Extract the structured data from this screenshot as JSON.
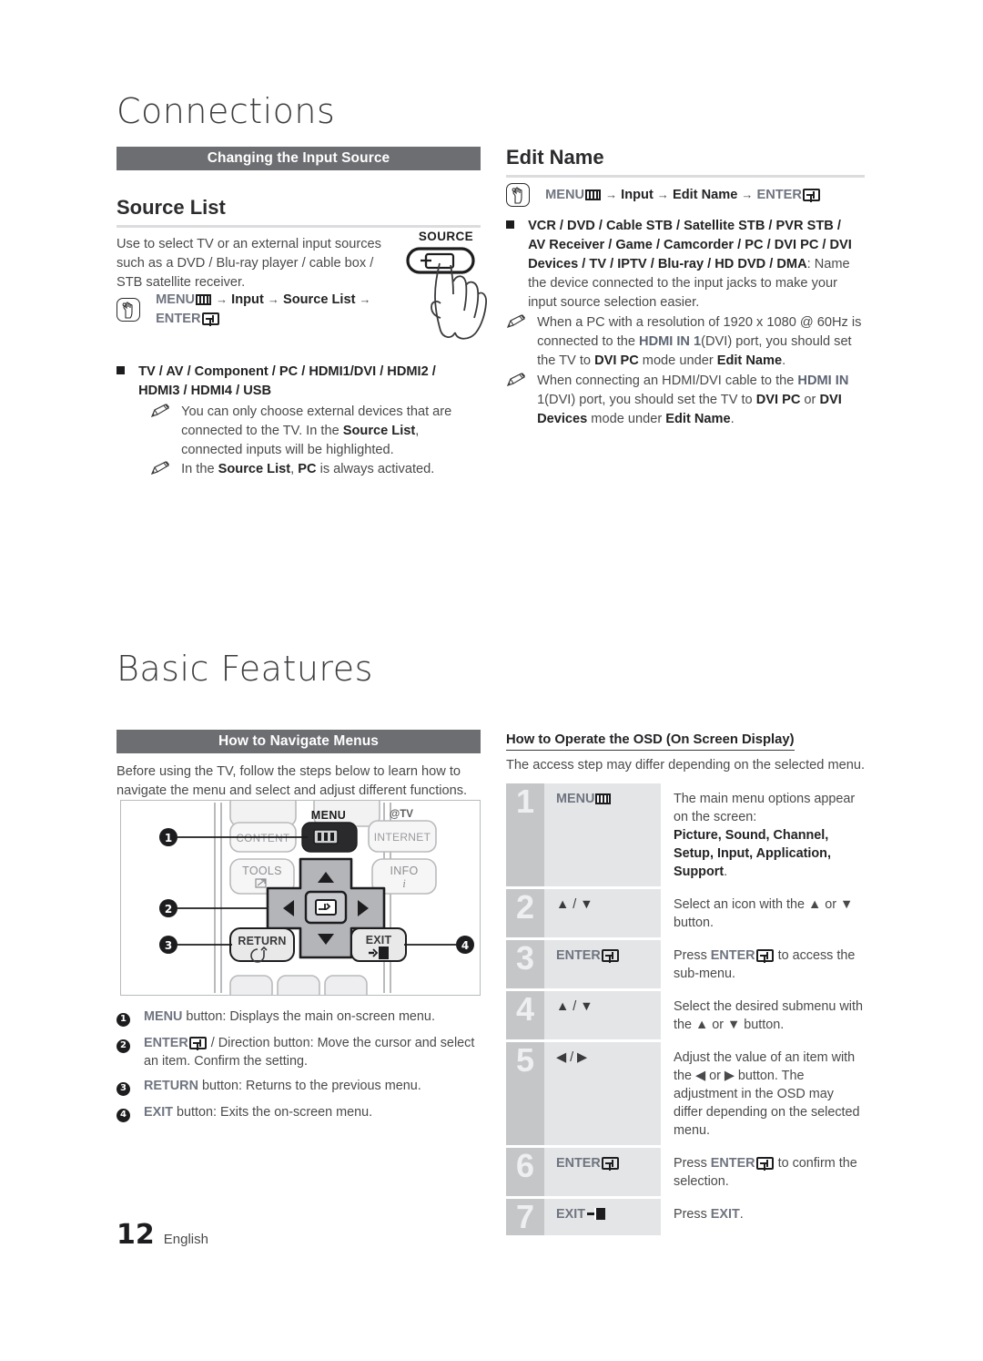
{
  "chapters": {
    "connections": "Connections",
    "basic_features": "Basic Features"
  },
  "section_bars": {
    "changing_input_source": "Changing the Input Source",
    "how_to_navigate_menus": "How to Navigate Menus"
  },
  "source_list": {
    "heading": "Source List",
    "intro": "Use to select TV or an external input sources such as a DVD / Blu-ray player / cable box / STB satellite receiver.",
    "menu_path": {
      "menu": "MENU",
      "arrow": "→",
      "input": "Input",
      "source_list": "Source List",
      "enter": "ENTER"
    },
    "inputs_bullet": "TV / AV / Component / PC / HDMI1/DVI / HDMI2 / HDMI3 / HDMI4 / USB",
    "notes": [
      "You can only choose external devices that are connected to the TV. In the Source List, connected inputs will be highlighted.",
      "In the Source List, PC is always activated."
    ],
    "source_button_label": "SOURCE"
  },
  "edit_name": {
    "heading": "Edit Name",
    "menu_path": {
      "menu": "MENU",
      "arrow": "→",
      "input": "Input",
      "edit_name": "Edit Name",
      "enter": "ENTER"
    },
    "devices_bold": "VCR / DVD / Cable STB / Satellite STB / PVR STB / AV Receiver / Game / Camcorder / PC / DVI PC / DVI Devices / TV / IPTV / Blu-ray / HD DVD / DMA",
    "devices_tail": ": Name the device connected to the input jacks to make your input source selection easier.",
    "notes": [
      "When a PC with a resolution of 1920 x 1080 @ 60Hz is connected to the HDMI IN 1(DVI) port, you should set the TV to DVI PC mode under Edit Name.",
      "When connecting an HDMI/DVI cable to the HDMI IN 1(DVI) port, you should set the TV to DVI PC or DVI Devices mode under Edit Name."
    ]
  },
  "navigate_menus": {
    "intro": "Before using the TV, follow the steps below to learn how to navigate the menu and select and adjust different functions.",
    "remote_buttons": {
      "content": "CONTENT",
      "menu_label": "MENU",
      "attv": "@TV",
      "internet": "INTERNET",
      "tools": "TOOLS",
      "info": "INFO",
      "return": "RETURN",
      "exit": "EXIT"
    },
    "callouts": [
      "1",
      "2",
      "3",
      "4"
    ],
    "legend": [
      {
        "num": "1",
        "key": "MENU",
        "text": " button: Displays the main on-screen menu."
      },
      {
        "num": "2",
        "key": "ENTER",
        "text": " / Direction button: Move the cursor and select an item. Confirm the setting."
      },
      {
        "num": "3",
        "key": "RETURN",
        "text": " button: Returns to the previous menu."
      },
      {
        "num": "4",
        "key": "EXIT",
        "text": " button: Exits the on-screen menu."
      }
    ]
  },
  "osd": {
    "title": "How to Operate the OSD (On Screen Display)",
    "subtitle": "The access step may differ depending on the selected menu.",
    "rows": [
      {
        "num": "1",
        "key": "MENU",
        "key_icon": "menu-icon",
        "desc_lead": "The main menu options appear on the screen:",
        "desc_bold": "Picture, Sound, Channel, Setup, Input, Application, Support",
        "desc_tail": "."
      },
      {
        "num": "2",
        "key": "▲ / ▼",
        "key_icon": "",
        "desc_lead": "Select an icon with the ▲ or ▼ button.",
        "desc_bold": "",
        "desc_tail": ""
      },
      {
        "num": "3",
        "key": "ENTER",
        "key_icon": "enter-icon",
        "desc_lead": "Press ENTER to access the sub-menu.",
        "desc_bold": "",
        "desc_tail": ""
      },
      {
        "num": "4",
        "key": "▲ / ▼",
        "key_icon": "",
        "desc_lead": "Select the desired submenu with the ▲ or ▼ button.",
        "desc_bold": "",
        "desc_tail": ""
      },
      {
        "num": "5",
        "key": "◀ / ▶",
        "key_icon": "",
        "desc_lead": "Adjust the value of an item with the ◀ or ▶ button. The adjustment in the OSD may differ depending on the selected menu.",
        "desc_bold": "",
        "desc_tail": ""
      },
      {
        "num": "6",
        "key": "ENTER",
        "key_icon": "enter-icon",
        "desc_lead": "Press ENTER to confirm the selection.",
        "desc_bold": "",
        "desc_tail": ""
      },
      {
        "num": "7",
        "key": "EXIT",
        "key_icon": "exit-icon",
        "desc_lead": "Press EXIT.",
        "desc_bold": "",
        "desc_tail": ""
      }
    ]
  },
  "footer": {
    "page_number": "12",
    "language": "English"
  },
  "colors": {
    "section_bar": "#6d6e72",
    "key_text": "#6f7480",
    "osd_num_bg": "#c5c6c8",
    "osd_key_bg": "#e4e5e7",
    "rule": "#dcdcde"
  }
}
